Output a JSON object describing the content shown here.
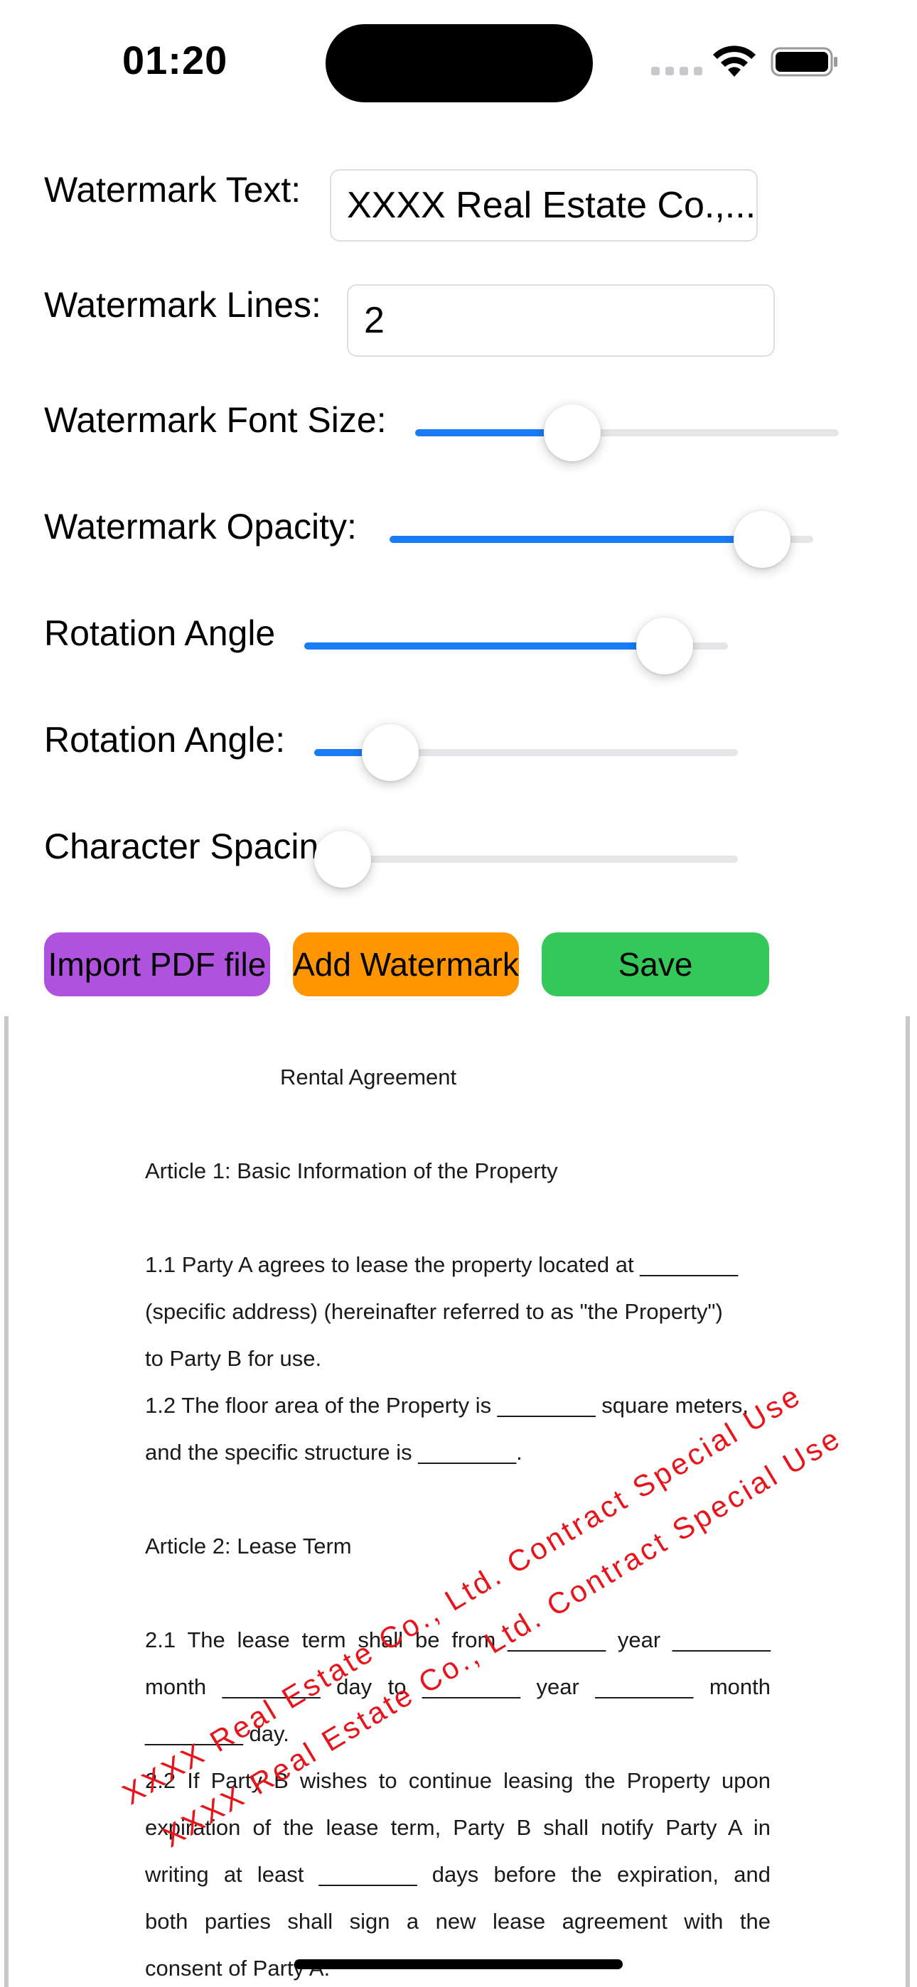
{
  "status_bar": {
    "time": "01:20"
  },
  "form": {
    "watermark_text_label": "Watermark Text:",
    "watermark_text_value": "XXXX Real Estate Co.,...",
    "watermark_lines_label": "Watermark Lines:",
    "watermark_lines_value": "2",
    "font_size_label": "Watermark Font Size:",
    "font_size_level": 0.37,
    "opacity_label": "Watermark Opacity:",
    "opacity_level": 0.88,
    "rotation_label_1": "Rotation Angle",
    "rotation_level_1": 0.85,
    "rotation_label_2": "Rotation Angle:",
    "rotation_level_2": 0.18,
    "spacing_label": "Character Spacing:",
    "spacing_level": 0.0
  },
  "buttons": {
    "import_label": "Import PDF file",
    "import_color": "#af52de",
    "add_label": "Add Watermark",
    "add_color": "#ff9500",
    "save_label": "Save",
    "save_color": "#34c759"
  },
  "document": {
    "title": "Rental Agreement",
    "article1": "Article 1: Basic Information of the Property",
    "p1_1": "1.1 Party A agrees to lease the property located at ________",
    "p1_2": "(specific address) (hereinafter referred to as \"the Property\")",
    "p1_3": "to Party B for use.",
    "p1_4": "1.2 The floor area of the Property is ________ square meters,",
    "p1_5": "and the specific structure is ________.",
    "article2": "Article 2: Lease Term",
    "p2_1": "2.1 The lease term shall be from ________ year ________",
    "p2_2": "month ________ day to ________ year ________ month",
    "p2_3": "________ day.",
    "p2_4": "2.2 If Party B wishes to continue leasing the Property upon",
    "p2_5": "expiration of the lease term, Party B shall notify Party A in",
    "p2_6": "writing at least ________ days before the expiration, and",
    "p2_7": "both parties shall sign a new lease agreement with the",
    "p2_8": "consent of Party A."
  },
  "watermark": {
    "line_1": "XXXX Real Estate Co., Ltd. Contract Special Use",
    "line_2": "XXXX Real Estate Co., Ltd. Contract Special Use",
    "color": "#e8141c"
  }
}
